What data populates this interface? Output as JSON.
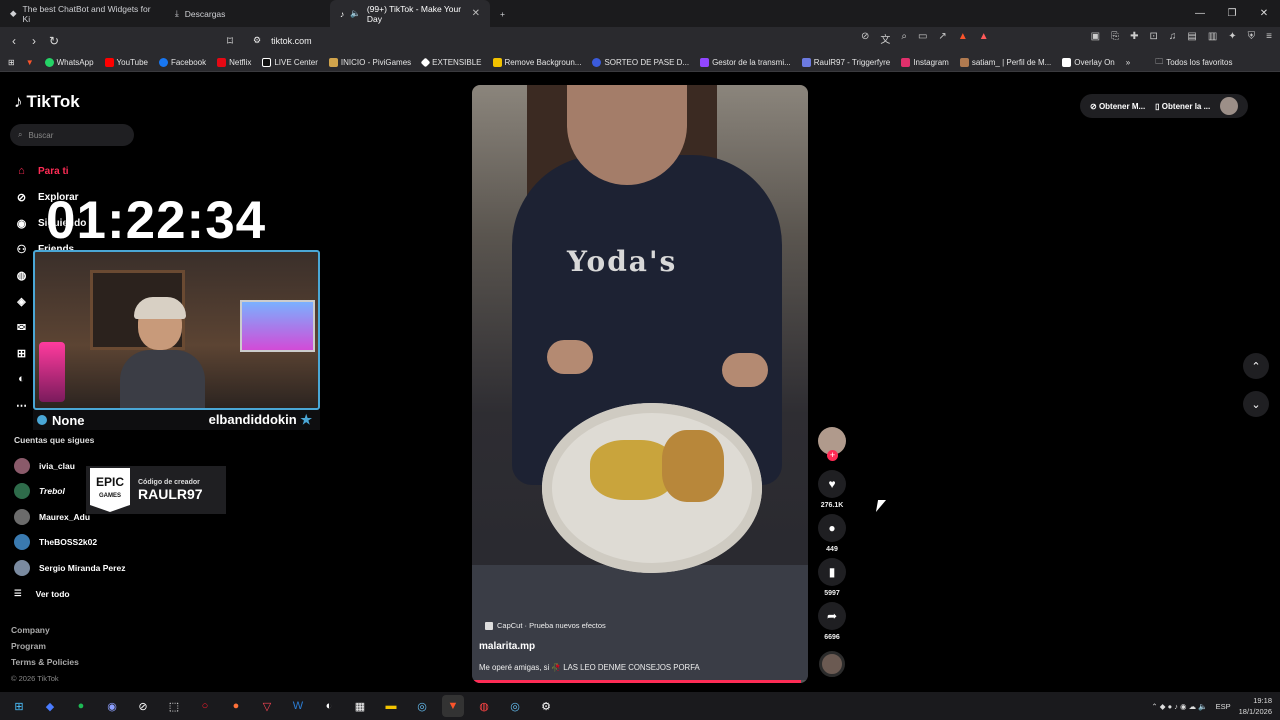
{
  "browser": {
    "tabs": [
      {
        "label": "The best ChatBot and Widgets for Ki",
        "icon": "chatbot-icon"
      },
      {
        "label": "Descargas",
        "icon": "download-icon"
      },
      {
        "label": "(99+) TikTok - Make Your Day",
        "icon": "tiktok-icon"
      }
    ],
    "new_tab": "+",
    "url": "tiktok.com",
    "bookmarks": [
      {
        "label": "WhatsApp",
        "color": "#25d366"
      },
      {
        "label": "YouTube",
        "color": "#ff0000"
      },
      {
        "label": "Facebook",
        "color": "#1877f2"
      },
      {
        "label": "Netflix",
        "color": "#e50914"
      },
      {
        "label": "LIVE Center",
        "color": "#ffffff"
      },
      {
        "label": "INICIO - PiviGames",
        "color": "#d1a44c"
      },
      {
        "label": "EXTENSIBLE",
        "color": "#ffffff"
      },
      {
        "label": "Remove Backgroun...",
        "color": "#f2c200"
      },
      {
        "label": "SORTEO DE PASE D...",
        "color": "#3b5bdb"
      },
      {
        "label": "Gestor de la transmi...",
        "color": "#9146ff"
      },
      {
        "label": "RaulR97 - Triggerfyre",
        "color": "#6c7ae0"
      },
      {
        "label": "Instagram",
        "color": "#e1306c"
      },
      {
        "label": "satiam_ | Perfil de M...",
        "color": "#b07a50"
      },
      {
        "label": "Overlay On",
        "color": "#ffffff"
      }
    ],
    "more_bookmarks": "»",
    "all_favorites": "Todos los favoritos"
  },
  "tiktok": {
    "logo": "TikTok",
    "search_placeholder": "Buscar",
    "menu": [
      {
        "label": "Para ti",
        "icon": "home-icon",
        "active": true
      },
      {
        "label": "Explorar",
        "icon": "compass-icon"
      },
      {
        "label": "Siguiendo",
        "icon": "following-icon"
      },
      {
        "label": "Friends",
        "icon": "friends-icon"
      }
    ],
    "following_title": "Cuentas que sigues",
    "following": [
      {
        "name": "ivia_clau"
      },
      {
        "name": "Trebol"
      },
      {
        "name": "Maurex_Adu"
      },
      {
        "name": "TheBOSS2k02"
      },
      {
        "name": "Sergio Miranda Perez"
      }
    ],
    "see_all": "Ver todo",
    "footer": [
      "Company",
      "Program",
      "Terms & Policies"
    ],
    "copyright": "© 2026 TikTok",
    "top_right": {
      "btn1": "Obtener M...",
      "btn2": "Obtener la ..."
    },
    "video": {
      "hoodie_text": "Yoda's",
      "effect": "CapCut · Prueba nuevos efectos",
      "author": "malarita.mp",
      "description": "Me operé amigas, si 🥀 LAS LEO DENME CONSEJOS PORFA",
      "progress": 0.98
    },
    "actions": {
      "likes": "276.1K",
      "comments": "449",
      "saves": "5997",
      "shares": "6696"
    }
  },
  "overlay": {
    "timer": "01:22:34",
    "name_left": "None",
    "name_right": "elbandiddokin",
    "epic_logo_top": "EPIC",
    "epic_logo_bottom": "GAMES",
    "creator_code_label": "Código de creador",
    "creator_code": "RAULR97"
  },
  "taskbar": {
    "lang": "ESP",
    "time": "19:18",
    "date": "18/1/2026"
  }
}
